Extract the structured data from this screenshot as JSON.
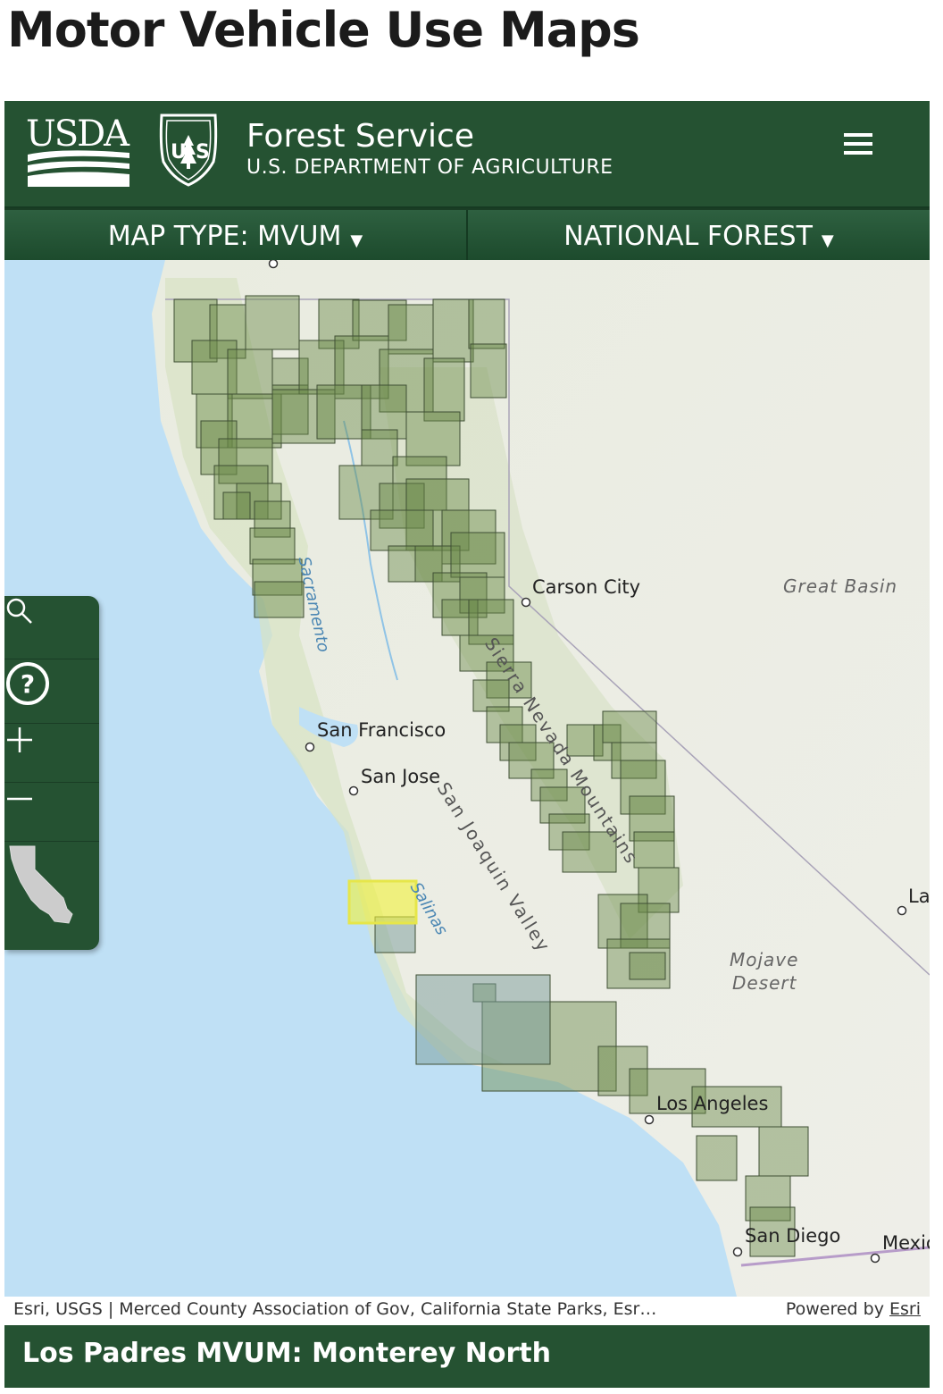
{
  "page": {
    "title": "Motor Vehicle Use Maps"
  },
  "header": {
    "usda_logo_text": "USDA",
    "shield_text": "FOREST SERVICE",
    "agency_name": "Forest Service",
    "department": "U.S. DEPARTMENT OF AGRICULTURE",
    "menu_icon": "hamburger-icon"
  },
  "subnav": {
    "map_type_label": "MAP TYPE: MVUM",
    "national_forest_label": "NATIONAL FOREST",
    "caret": "▼"
  },
  "map": {
    "cities": [
      "Carson City",
      "San Francisco",
      "San Jose",
      "Los Angeles",
      "San Diego",
      "La",
      "Mexic"
    ],
    "regions": [
      "Great Basin",
      "Mojave",
      "Desert"
    ],
    "water_labels": [
      "Sacramento",
      "Salinas"
    ],
    "features": [
      "Sierra Nevada Mountains",
      "San Joaquin Valley"
    ],
    "colors": {
      "quad_fill": "#6b8a4a",
      "selected_fill": "#f2f23a",
      "header_green": "#255232"
    }
  },
  "toolbar": {
    "tools": [
      "search-icon",
      "help-icon",
      "zoom-in-icon",
      "zoom-out-icon",
      "california-state-icon"
    ]
  },
  "attribution": {
    "sources": "Esri, USGS | Merced County Association of Gov, California State Parks, Esr…",
    "powered_by": "Powered by",
    "esri_link": "Esri"
  },
  "footer": {
    "selected_map": "Los Padres MVUM: Monterey North"
  }
}
